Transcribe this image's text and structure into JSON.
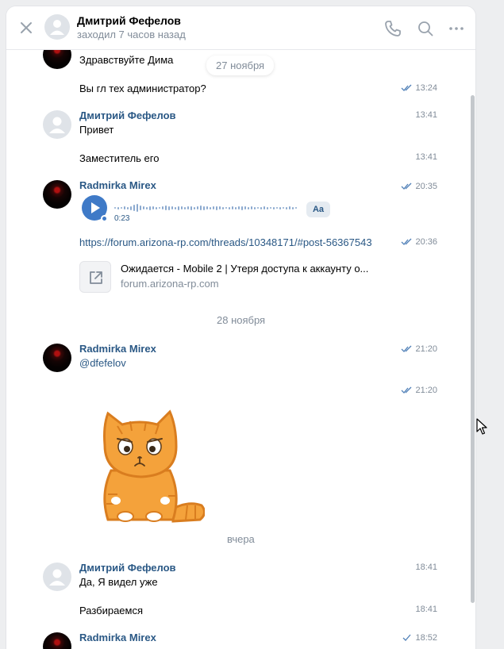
{
  "header": {
    "name": "Дмитрий Фефелов",
    "status": "заходил 7 часов назад"
  },
  "messages": {
    "m1": {
      "text": "Здравствуйте Дима"
    },
    "m2": {
      "text": "Вы гл тех администратор?",
      "time": "13:24"
    },
    "m3": {
      "author": "Дмитрий Фефелов",
      "text": "Привет",
      "time": "13:41"
    },
    "m4": {
      "text": "Заместитель его",
      "time": "13:41"
    },
    "m5": {
      "author": "Radmirka Mirex",
      "time": "20:35",
      "voice_duration": "0:23",
      "transcribe_label": "Aa"
    },
    "m6": {
      "link": "https://forum.arizona-rp.com/threads/10348171/#post-56367543",
      "time": "20:36",
      "snippet_title": "Ожидается - Mobile 2 | Утеря доступа к аккаунту о...",
      "snippet_domain": "forum.arizona-rp.com"
    },
    "m7": {
      "author": "Radmirka Mirex",
      "text": "@dfefelov",
      "time": "21:20"
    },
    "m8": {
      "time": "21:20"
    },
    "m9": {
      "author": "Дмитрий Фефелов",
      "text": "Да, Я видел уже",
      "time": "18:41"
    },
    "m10": {
      "text": "Разбираемся",
      "time": "18:41"
    },
    "m11": {
      "author": "Radmirka Mirex",
      "time": "18:52"
    }
  },
  "dates": {
    "pill": "27 ноября",
    "d2": "28 ноября",
    "d3": "вчера"
  },
  "colors": {
    "accent": "#2a5885",
    "meta": "#818c99",
    "play": "#3f7ac7"
  }
}
